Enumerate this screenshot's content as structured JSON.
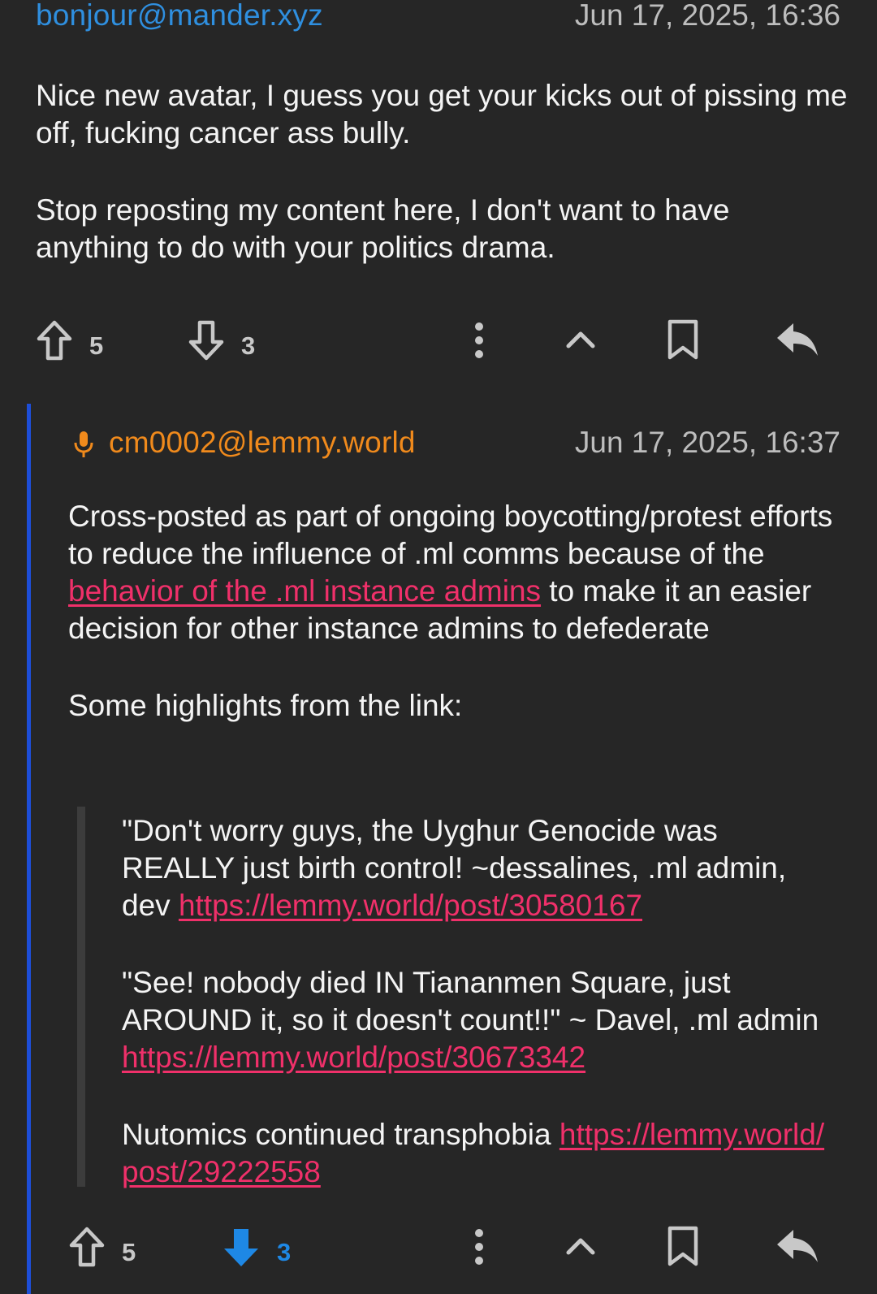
{
  "comments": [
    {
      "user": "bonjour@mander.xyz",
      "time": "Jun 17, 2025, 16:36",
      "paragraphs": [
        "Nice new avatar, I guess you get your kicks out of pissing me off, fucking cancer ass bully.",
        "Stop reposting my content here, I don't want to have anything to do with your politics drama."
      ],
      "upvotes": "5",
      "downvotes": "3"
    },
    {
      "user": "cm0002@lemmy.world",
      "time": "Jun 17, 2025, 16:37",
      "p1_before": "Cross-posted as part of ongoing boycotting/protest efforts to reduce the influence of .ml comms because of the ",
      "p1_link": "behavior of the .ml instance admins",
      "p1_after": " to make it an easier decision for other instance admins to defederate",
      "p2": "Some highlights from the link:",
      "quotes": [
        {
          "text": "\"Don't worry guys, the Uyghur Genocide was REALLY just birth control! ~dessalines, .ml admin, dev ",
          "link": "https://lemmy.world/post/30580167"
        },
        {
          "text": "\"See! nobody died IN Tiananmen Square, just AROUND it, so it doesn't count!!\" ~ Davel, .ml admin ",
          "link": "https://lemmy.world/post/30673342"
        },
        {
          "text": "Nutomics continued transphobia ",
          "link": "https://lemmy.world/post/29222558"
        }
      ],
      "upvotes": "5",
      "downvotes": "3"
    }
  ],
  "colors": {
    "background": "#262626",
    "username_1": "#2f8fdf",
    "username_2": "#f08a1c",
    "link": "#f0306a",
    "thread_bar": "#1d4ed8",
    "active_vote": "#1e88e5"
  },
  "icons": [
    "arrow-up-outline-icon",
    "arrow-down-outline-icon",
    "more-vertical-icon",
    "chevron-up-icon",
    "bookmark-icon",
    "reply-icon",
    "microphone-icon"
  ]
}
